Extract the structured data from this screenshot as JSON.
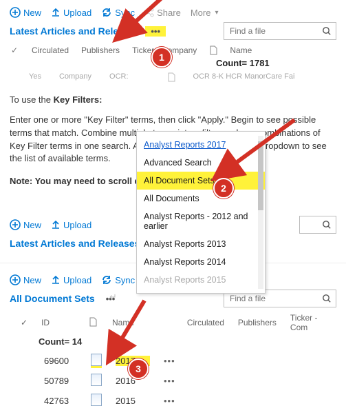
{
  "toolbar": {
    "new": "New",
    "upload": "Upload",
    "sync": "Sync",
    "share": "Share",
    "more": "More"
  },
  "search": {
    "placeholder": "Find a file"
  },
  "pane1": {
    "view": "Latest Articles and Releases",
    "cols": {
      "circulated": "Circulated",
      "publishers": "Publishers",
      "tickercompany": "Ticker - Company",
      "name": "Name"
    },
    "count_label": "Count= 1781",
    "faint": {
      "a": "Yes",
      "b": "Company",
      "c": "OCR:",
      "d": "OCR 8-K HCR ManorCare Fai"
    }
  },
  "instr": {
    "l1a": "To use the ",
    "l1b": "Key Filters:",
    "p1": "Enter one or more \"Key Filter\" terms, then click \"Apply.\" Begin to see possible terms that match. Combine multiple terms into a filter, and use combinations of Key Filter terms in one search. Alternately, you can click on the dropdown to see the list of available terms.",
    "note": "Note: You may need to scroll down"
  },
  "menu": {
    "items": [
      "Analyst Reports 2017",
      "Advanced Search",
      "All Document Sets",
      "All Documents",
      "Analyst Reports - 2012 and earlier",
      "Analyst Reports 2013",
      "Analyst Reports 2014",
      "Analyst Reports 2015"
    ]
  },
  "pane2": {
    "view": "Latest Articles and Releases"
  },
  "pane3": {
    "view": "All Document Sets",
    "cols": {
      "id": "ID",
      "name": "Name",
      "circulated": "Circulated",
      "publishers": "Publishers",
      "tickercompany": "Ticker - Com"
    },
    "count_label": "Count= 14",
    "rows": [
      {
        "id": "69600",
        "name": "2017"
      },
      {
        "id": "50789",
        "name": "2016"
      },
      {
        "id": "42763",
        "name": "2015"
      }
    ]
  },
  "badges": {
    "b1": "1",
    "b2": "2",
    "b3": "3"
  }
}
